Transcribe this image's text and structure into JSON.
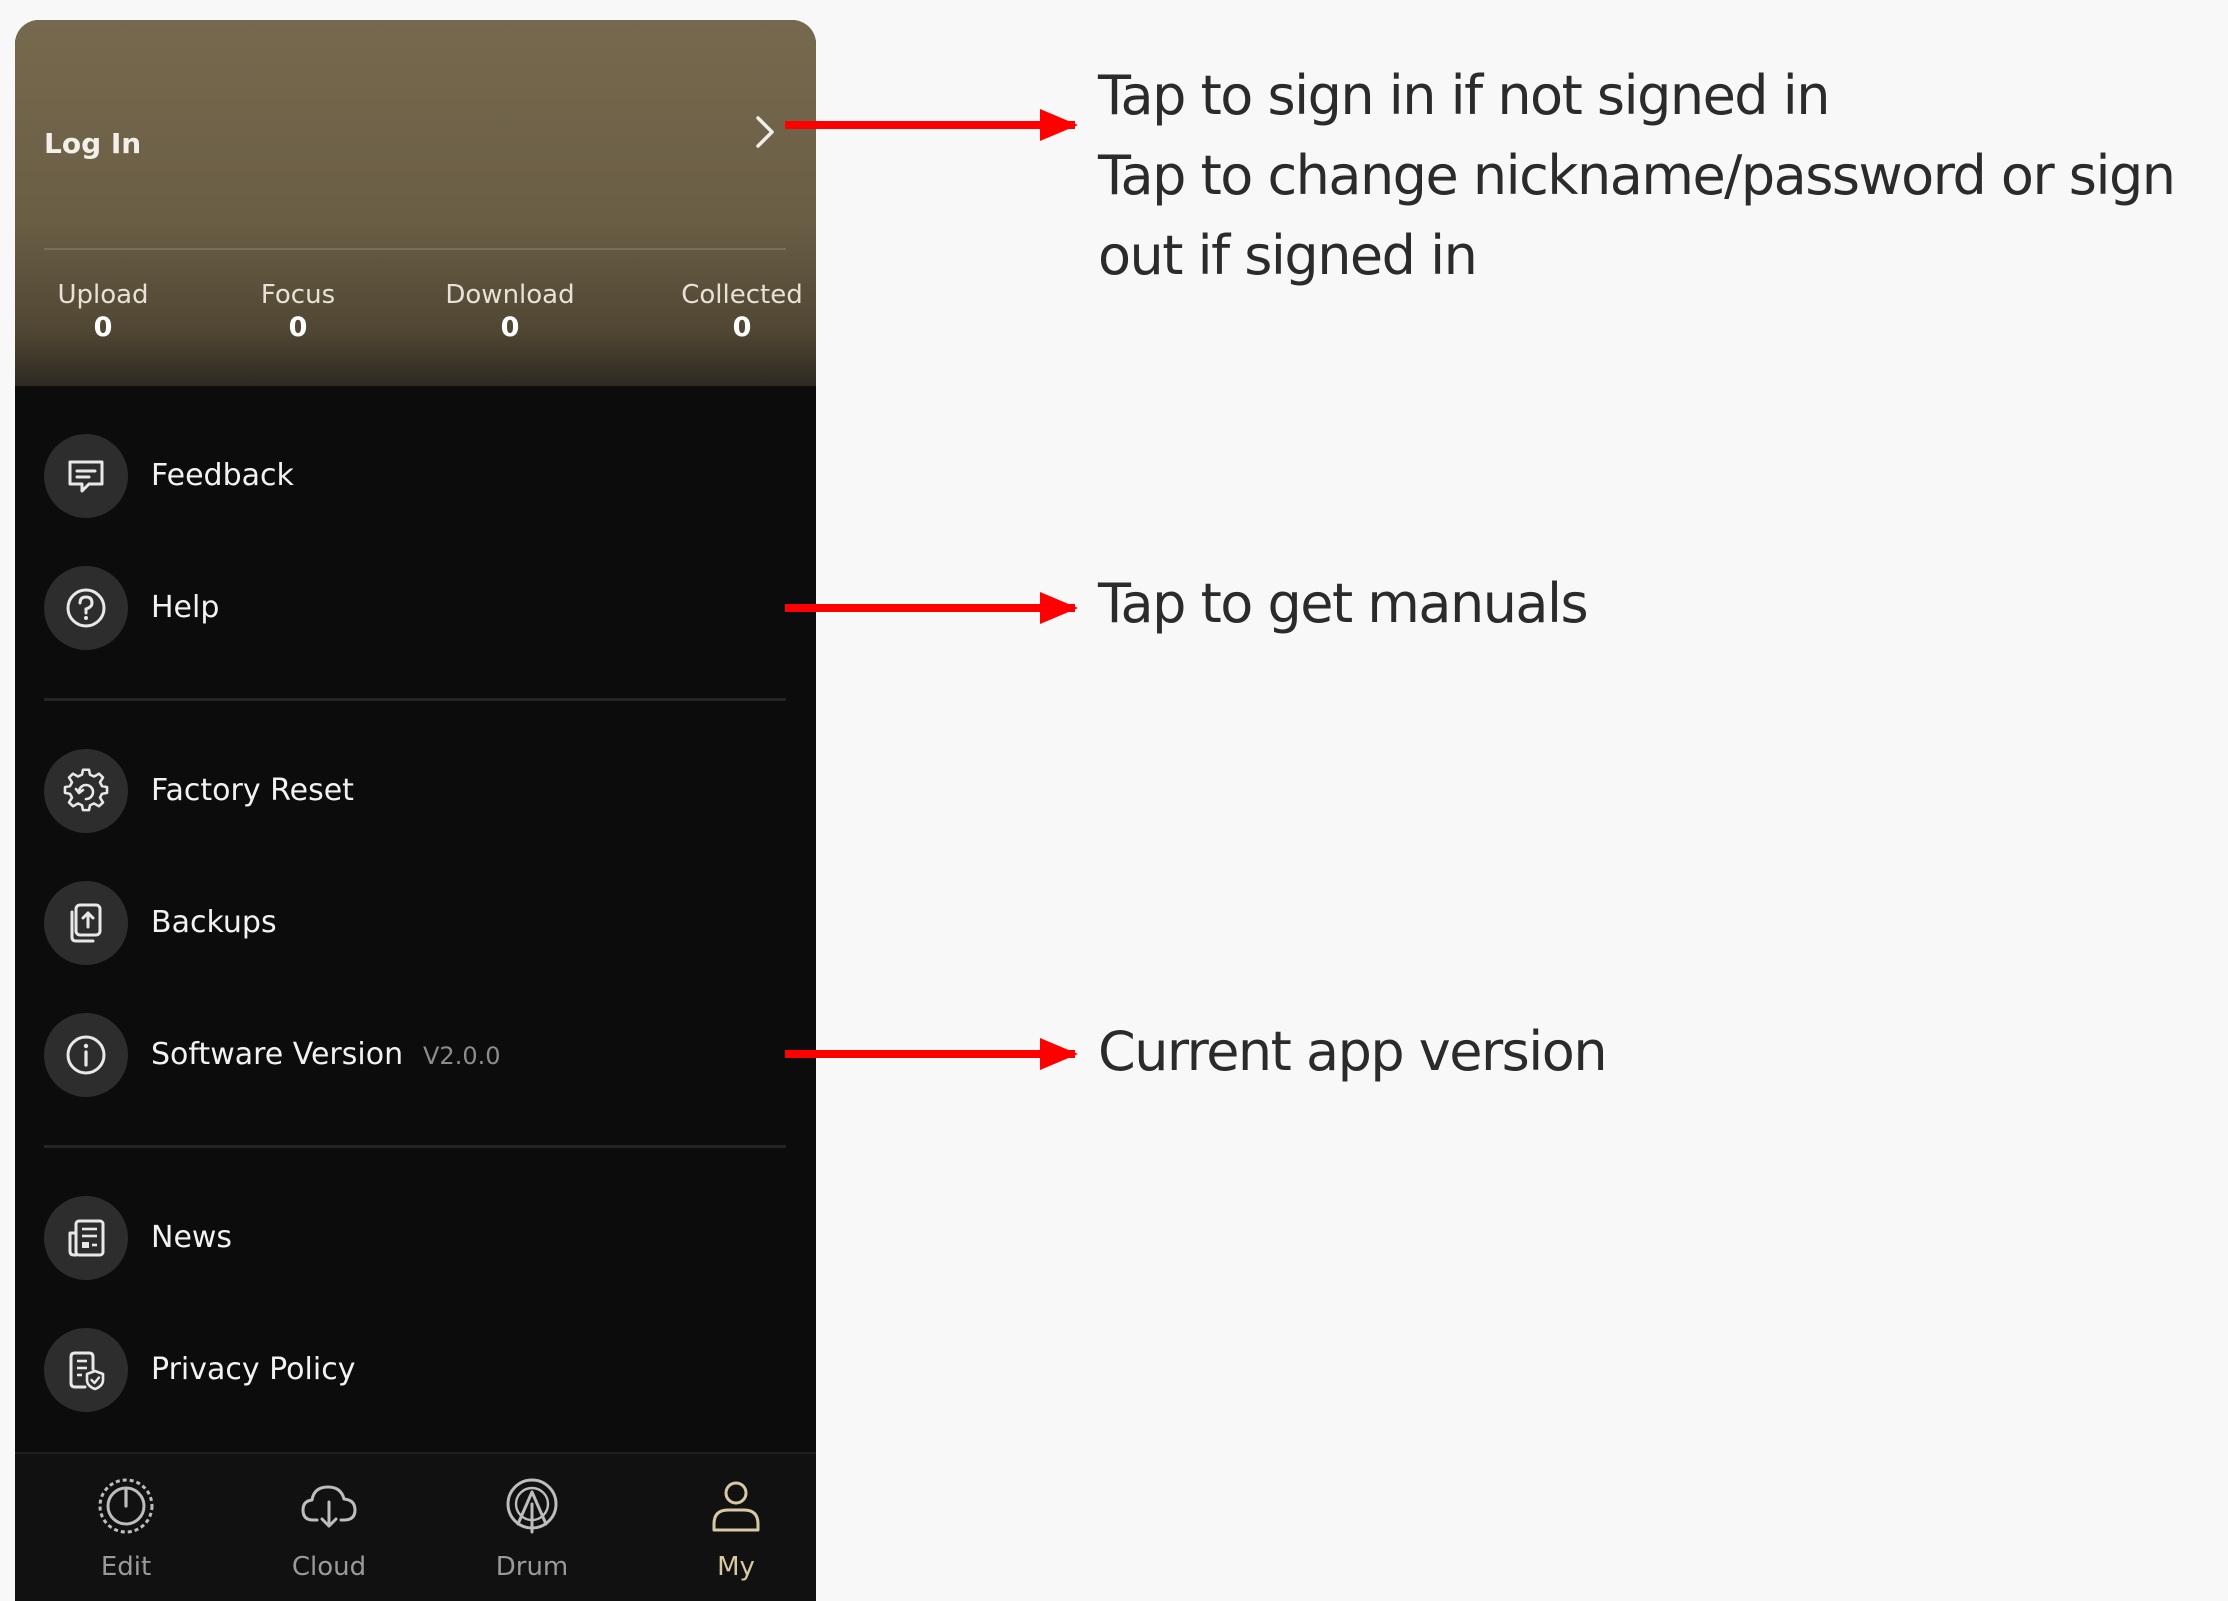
{
  "header": {
    "login_label": "Log In",
    "stats": [
      {
        "label": "Upload",
        "value": "0"
      },
      {
        "label": "Focus",
        "value": "0"
      },
      {
        "label": "Download",
        "value": "0"
      },
      {
        "label": "Collected",
        "value": "0"
      }
    ]
  },
  "menu": {
    "feedback": "Feedback",
    "help": "Help",
    "factory_reset": "Factory Reset",
    "backups": "Backups",
    "software_version": "Software Version",
    "version_value": "V2.0.0",
    "news": "News",
    "privacy_policy": "Privacy Policy"
  },
  "tabbar": {
    "tabs": [
      {
        "label": "Edit",
        "icon": "edit-knob-icon"
      },
      {
        "label": "Cloud",
        "icon": "cloud-download-icon"
      },
      {
        "label": "Drum",
        "icon": "drum-icon"
      },
      {
        "label": "My",
        "icon": "user-icon"
      }
    ],
    "active_tab": "My"
  },
  "annotations": {
    "login_line1": "Tap to sign in if not signed in",
    "login_line2": "Tap to change nickname/password or sign",
    "login_line3": "out if signed in",
    "help": "Tap to get manuals",
    "version": "Current app version"
  },
  "colors": {
    "header_top": "#76694e",
    "app_background": "#0c0c0c",
    "arrow": "#ff0000",
    "active_tab": "#d8c9a2"
  }
}
